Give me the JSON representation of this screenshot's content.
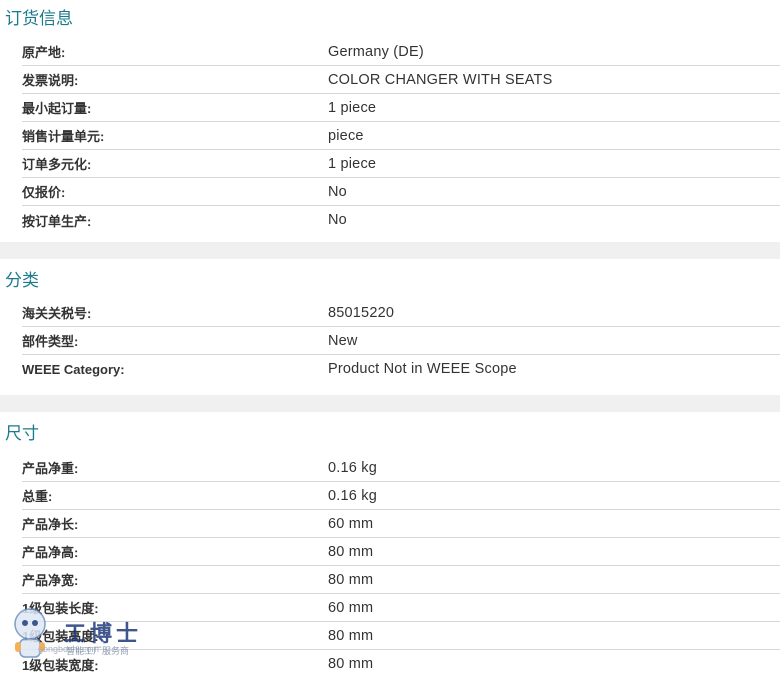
{
  "sections": {
    "order": {
      "title": "订货信息",
      "rows": [
        {
          "label": "原产地:",
          "value": "Germany (DE)"
        },
        {
          "label": "发票说明:",
          "value": "COLOR CHANGER WITH SEATS"
        },
        {
          "label": "最小起订量:",
          "value": "1 piece"
        },
        {
          "label": "销售计量单元:",
          "value": "piece"
        },
        {
          "label": "订单多元化:",
          "value": "1 piece"
        },
        {
          "label": "仅报价:",
          "value": "No"
        },
        {
          "label": "按订单生产:",
          "value": "No"
        }
      ]
    },
    "classification": {
      "title": "分类",
      "rows": [
        {
          "label": "海关关税号:",
          "value": "85015220"
        },
        {
          "label": "部件类型:",
          "value": "New"
        },
        {
          "label": "WEEE Category:",
          "value": "Product Not in WEEE Scope"
        }
      ]
    },
    "dimensions": {
      "title": "尺寸",
      "rows": [
        {
          "label": "产品净重:",
          "value": "0.16 kg"
        },
        {
          "label": "总重:",
          "value": "0.16 kg"
        },
        {
          "label": "产品净长:",
          "value": "60 mm"
        },
        {
          "label": "产品净高:",
          "value": "80 mm"
        },
        {
          "label": "产品净宽:",
          "value": "80 mm"
        },
        {
          "label": "1级包装长度:",
          "value": "60 mm"
        },
        {
          "label": "1级包装高度:",
          "value": "80 mm"
        },
        {
          "label": "1级包装宽度:",
          "value": "80 mm"
        }
      ]
    }
  },
  "watermark": {
    "title": "工博士",
    "subtitle": "智能工厂服务商",
    "url": "gongboshi.com"
  }
}
